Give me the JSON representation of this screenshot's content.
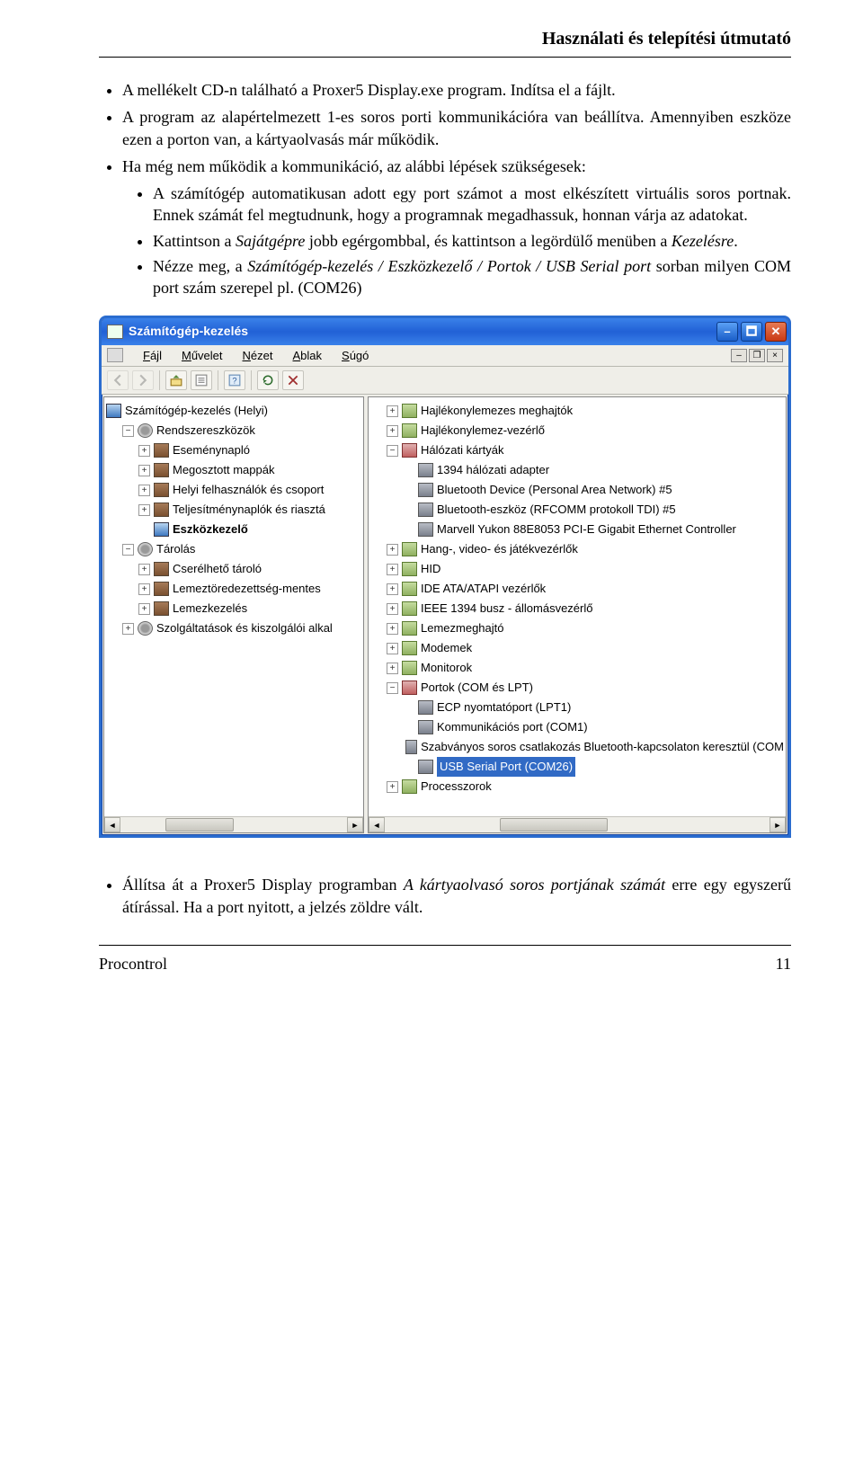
{
  "header": {
    "title": "Használati és telepítési útmutató"
  },
  "intro": {
    "b1": "A mellékelt CD-n található a Proxer5 Display.exe program. Indítsa el a fájlt.",
    "b2": "A program az alapértelmezett 1-es soros porti kommunikációra van beállítva. Amennyiben eszköze ezen a porton van, a kártyaolvasás már működik.",
    "b3": "Ha még nem működik a kommunikáció, az alábbi lépések szükségesek:",
    "s1": "A számítógép automatikusan adott egy port számot a most elkészített virtuális soros portnak. Ennek számát fel megtudnunk, hogy a programnak megadhassuk, honnan várja az adatokat.",
    "s2_a": "Kattintson a ",
    "s2_i": "Sajátgépre",
    "s2_b": " jobb egérgombbal, és kattintson a legördülő menüben a ",
    "s2_i2": "Kezelésre",
    "s2_c": ".",
    "s3_a": "Nézze meg, a ",
    "s3_i": "Számítógép-kezelés / Eszközkezelő / Portok / USB Serial port",
    "s3_b": " sorban milyen COM port szám szerepel pl. (COM26)"
  },
  "window": {
    "title": "Számítógép-kezelés",
    "menu": {
      "file": "Fájl",
      "action": "Művelet",
      "view": "Nézet",
      "window": "Ablak",
      "help": "Súgó"
    },
    "left_tree": [
      [
        "root",
        "Számítógép-kezelés (Helyi)"
      ],
      [
        "node",
        "Rendszereszközök"
      ],
      [
        "leaf",
        "Eseménynapló"
      ],
      [
        "leaf",
        "Megosztott mappák"
      ],
      [
        "leaf",
        "Helyi felhasználók és csoport"
      ],
      [
        "leaf",
        "Teljesítménynaplók és riasztá"
      ],
      [
        "leaf_bold",
        "Eszközkezelő"
      ],
      [
        "node",
        "Tárolás"
      ],
      [
        "leaf",
        "Cserélhető tároló"
      ],
      [
        "leaf",
        "Lemeztöredezettség-mentes"
      ],
      [
        "leaf",
        "Lemezkezelés"
      ],
      [
        "node_closed",
        "Szolgáltatások és kiszolgálói alkal"
      ]
    ],
    "right_tree": [
      [
        "p",
        "Hajlékonylemezes meghajtók"
      ],
      [
        "p",
        "Hajlékonylemez-vezérlő"
      ],
      [
        "m",
        "Hálózati kártyák"
      ],
      [
        "l",
        "1394 hálózati adapter"
      ],
      [
        "l",
        "Bluetooth Device (Personal Area Network) #5"
      ],
      [
        "l",
        "Bluetooth-eszköz (RFCOMM protokoll TDI) #5"
      ],
      [
        "l",
        "Marvell Yukon 88E8053 PCI-E Gigabit Ethernet Controller"
      ],
      [
        "p",
        "Hang-, video- és játékvezérlők"
      ],
      [
        "p",
        "HID"
      ],
      [
        "p",
        "IDE ATA/ATAPI vezérlők"
      ],
      [
        "p",
        "IEEE 1394 busz - állomásvezérlő"
      ],
      [
        "p",
        "Lemezmeghajtó"
      ],
      [
        "p",
        "Modemek"
      ],
      [
        "p",
        "Monitorok"
      ],
      [
        "m",
        "Portok (COM és LPT)"
      ],
      [
        "l",
        "ECP nyomtatóport (LPT1)"
      ],
      [
        "l",
        "Kommunikációs port (COM1)"
      ],
      [
        "l",
        "Szabványos soros csatlakozás Bluetooth-kapcsolaton keresztül (COM"
      ],
      [
        "sel",
        "USB Serial Port (COM26)"
      ],
      [
        "p",
        "Processzorok"
      ]
    ]
  },
  "outro": {
    "b1_a": "Állítsa át a Proxer5 Display programban ",
    "b1_i": "A kártyaolvasó soros portjának számát",
    "b1_b": " erre egy egyszerű átírással. Ha a port nyitott, a jelzés zöldre vált."
  },
  "footer": {
    "left": "Procontrol",
    "right": "11"
  }
}
